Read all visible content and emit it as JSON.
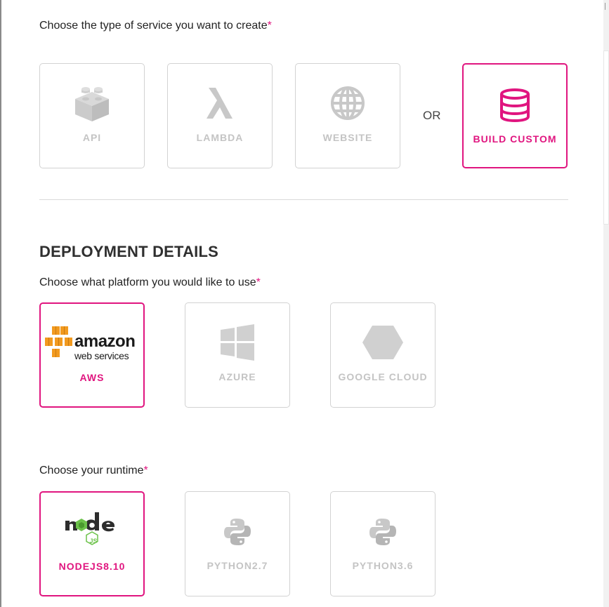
{
  "service": {
    "label": "Choose the type of service you want to create",
    "required": "*",
    "options": [
      {
        "label": "API",
        "icon": "lego-block-icon"
      },
      {
        "label": "LAMBDA",
        "icon": "lambda-icon"
      },
      {
        "label": "WEBSITE",
        "icon": "globe-icon"
      }
    ],
    "or_text": "OR",
    "custom": {
      "label": "BUILD CUSTOM",
      "icon": "database-icon",
      "selected": true
    }
  },
  "deployment": {
    "heading": "DEPLOYMENT DETAILS",
    "platform": {
      "label": "Choose what platform you would like to use",
      "required": "*",
      "options": [
        {
          "label": "AWS",
          "logo_text": "amazon",
          "logo_subtext": "web services",
          "icon": "aws-logo-icon",
          "selected": true
        },
        {
          "label": "AZURE",
          "icon": "windows-icon"
        },
        {
          "label": "GOOGLE CLOUD",
          "icon": "hexagon-icon"
        }
      ]
    },
    "runtime": {
      "label": "Choose your runtime",
      "required": "*",
      "options": [
        {
          "label": "NODEJS8.10",
          "logo_text": "node",
          "logo_badge": "JS",
          "icon": "nodejs-logo-icon",
          "selected": true
        },
        {
          "label": "PYTHON2.7",
          "icon": "python-icon"
        },
        {
          "label": "PYTHON3.6",
          "icon": "python-icon"
        }
      ]
    }
  },
  "colors": {
    "accent": "#e0157f",
    "disabled": "#c4c4c4",
    "border": "#d2d2d2",
    "aws_orange": "#f29a1f",
    "node_green": "#6cc24a"
  }
}
